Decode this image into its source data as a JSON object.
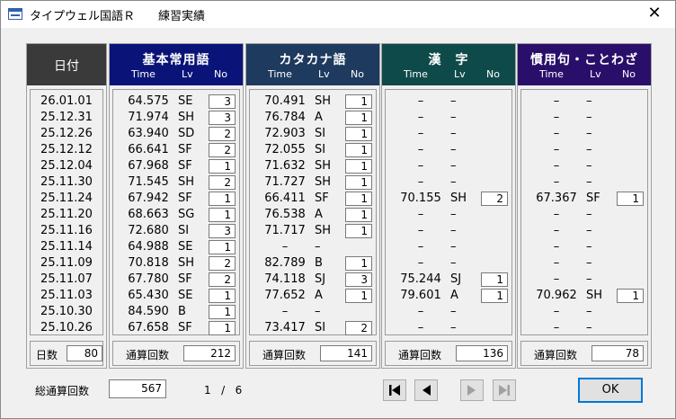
{
  "window": {
    "title": "タイプウェル国語Ｒ",
    "subtitle": "練習実績",
    "close_glyph": "✕"
  },
  "date_column": {
    "header": "日付",
    "dates": [
      "26.01.01",
      "25.12.31",
      "25.12.26",
      "25.12.12",
      "25.12.04",
      "25.11.30",
      "25.11.24",
      "25.11.20",
      "25.11.16",
      "25.11.14",
      "25.11.09",
      "25.11.07",
      "25.11.03",
      "25.10.30",
      "25.10.26"
    ],
    "footer_label": "日数",
    "footer_value": "80"
  },
  "columns": [
    {
      "title": "基本常用語",
      "header_color": "#0a1478",
      "sub_time": "Time",
      "sub_lv": "Lv",
      "sub_no": "No",
      "rows": [
        {
          "time": "64.575",
          "lv": "SE",
          "no": "3"
        },
        {
          "time": "71.974",
          "lv": "SH",
          "no": "3"
        },
        {
          "time": "63.940",
          "lv": "SD",
          "no": "2"
        },
        {
          "time": "66.641",
          "lv": "SF",
          "no": "2"
        },
        {
          "time": "67.968",
          "lv": "SF",
          "no": "1"
        },
        {
          "time": "71.545",
          "lv": "SH",
          "no": "2"
        },
        {
          "time": "67.942",
          "lv": "SF",
          "no": "1"
        },
        {
          "time": "68.663",
          "lv": "SG",
          "no": "1"
        },
        {
          "time": "72.680",
          "lv": "SI",
          "no": "3"
        },
        {
          "time": "64.988",
          "lv": "SE",
          "no": "1"
        },
        {
          "time": "70.818",
          "lv": "SH",
          "no": "2"
        },
        {
          "time": "67.780",
          "lv": "SF",
          "no": "2"
        },
        {
          "time": "65.430",
          "lv": "SE",
          "no": "1"
        },
        {
          "time": "84.590",
          "lv": "B",
          "no": "1"
        },
        {
          "time": "67.658",
          "lv": "SF",
          "no": "1"
        }
      ],
      "footer_label": "通算回数",
      "footer_value": "212"
    },
    {
      "title": "カタカナ語",
      "header_color": "#1e3a5f",
      "sub_time": "Time",
      "sub_lv": "Lv",
      "sub_no": "No",
      "rows": [
        {
          "time": "70.491",
          "lv": "SH",
          "no": "1"
        },
        {
          "time": "76.784",
          "lv": "A",
          "no": "1"
        },
        {
          "time": "72.903",
          "lv": "SI",
          "no": "1"
        },
        {
          "time": "72.055",
          "lv": "SI",
          "no": "1"
        },
        {
          "time": "71.632",
          "lv": "SH",
          "no": "1"
        },
        {
          "time": "71.727",
          "lv": "SH",
          "no": "1"
        },
        {
          "time": "66.411",
          "lv": "SF",
          "no": "1"
        },
        {
          "time": "76.538",
          "lv": "A",
          "no": "1"
        },
        {
          "time": "71.717",
          "lv": "SH",
          "no": "1"
        },
        {
          "time": "–",
          "lv": "–",
          "no": null
        },
        {
          "time": "82.789",
          "lv": "B",
          "no": "1"
        },
        {
          "time": "74.118",
          "lv": "SJ",
          "no": "3"
        },
        {
          "time": "77.652",
          "lv": "A",
          "no": "1"
        },
        {
          "time": "–",
          "lv": "–",
          "no": null
        },
        {
          "time": "73.417",
          "lv": "SI",
          "no": "2"
        }
      ],
      "footer_label": "通算回数",
      "footer_value": "141"
    },
    {
      "title": "漢　字",
      "header_color": "#0f4a4a",
      "sub_time": "Time",
      "sub_lv": "Lv",
      "sub_no": "No",
      "rows": [
        {
          "time": "–",
          "lv": "–",
          "no": null
        },
        {
          "time": "–",
          "lv": "–",
          "no": null
        },
        {
          "time": "–",
          "lv": "–",
          "no": null
        },
        {
          "time": "–",
          "lv": "–",
          "no": null
        },
        {
          "time": "–",
          "lv": "–",
          "no": null
        },
        {
          "time": "–",
          "lv": "–",
          "no": null
        },
        {
          "time": "70.155",
          "lv": "SH",
          "no": "2"
        },
        {
          "time": "–",
          "lv": "–",
          "no": null
        },
        {
          "time": "–",
          "lv": "–",
          "no": null
        },
        {
          "time": "–",
          "lv": "–",
          "no": null
        },
        {
          "time": "–",
          "lv": "–",
          "no": null
        },
        {
          "time": "75.244",
          "lv": "SJ",
          "no": "1"
        },
        {
          "time": "79.601",
          "lv": "A",
          "no": "1"
        },
        {
          "time": "–",
          "lv": "–",
          "no": null
        },
        {
          "time": "–",
          "lv": "–",
          "no": null
        }
      ],
      "footer_label": "通算回数",
      "footer_value": "136"
    },
    {
      "title": "慣用句・ことわざ",
      "header_color": "#2a0f6a",
      "sub_time": "Time",
      "sub_lv": "Lv",
      "sub_no": "No",
      "rows": [
        {
          "time": "–",
          "lv": "–",
          "no": null
        },
        {
          "time": "–",
          "lv": "–",
          "no": null
        },
        {
          "time": "–",
          "lv": "–",
          "no": null
        },
        {
          "time": "–",
          "lv": "–",
          "no": null
        },
        {
          "time": "–",
          "lv": "–",
          "no": null
        },
        {
          "time": "–",
          "lv": "–",
          "no": null
        },
        {
          "time": "67.367",
          "lv": "SF",
          "no": "1"
        },
        {
          "time": "–",
          "lv": "–",
          "no": null
        },
        {
          "time": "–",
          "lv": "–",
          "no": null
        },
        {
          "time": "–",
          "lv": "–",
          "no": null
        },
        {
          "time": "–",
          "lv": "–",
          "no": null
        },
        {
          "time": "–",
          "lv": "–",
          "no": null
        },
        {
          "time": "70.962",
          "lv": "SH",
          "no": "1"
        },
        {
          "time": "–",
          "lv": "–",
          "no": null
        },
        {
          "time": "–",
          "lv": "–",
          "no": null
        }
      ],
      "footer_label": "通算回数",
      "footer_value": "78"
    }
  ],
  "bottom": {
    "total_label": "総通算回数",
    "total_value": "567",
    "page_current": "1",
    "page_sep": "/",
    "page_total": "6",
    "ok_label": "OK",
    "nav_icons": [
      "first-page-icon",
      "prev-page-icon",
      "next-page-icon",
      "last-page-icon"
    ]
  },
  "colors": {
    "date_header": "#3a3a3a",
    "window_bg": "#f0f0f0",
    "ok_border": "#0078d7"
  }
}
